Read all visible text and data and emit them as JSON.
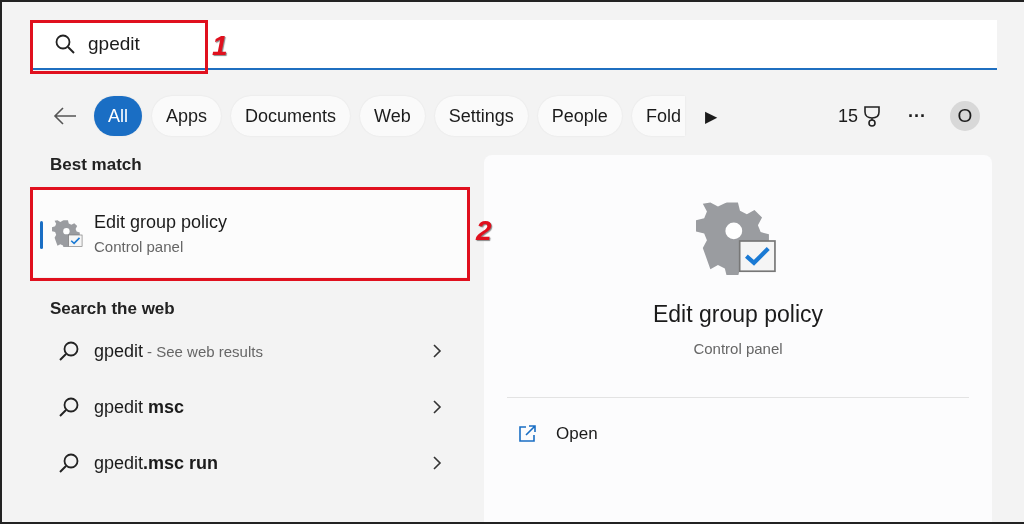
{
  "search": {
    "value": "gpedit"
  },
  "filters": [
    {
      "label": "All",
      "selected": true
    },
    {
      "label": "Apps",
      "selected": false
    },
    {
      "label": "Documents",
      "selected": false
    },
    {
      "label": "Web",
      "selected": false
    },
    {
      "label": "Settings",
      "selected": false
    },
    {
      "label": "People",
      "selected": false
    },
    {
      "label": "Fold",
      "selected": false
    }
  ],
  "more_filters": "▶",
  "points": "15",
  "more": "···",
  "avatar": "O",
  "best_match": {
    "heading": "Best match",
    "title": "Edit group policy",
    "subtitle": "Control panel",
    "selected": true
  },
  "web": {
    "heading": "Search the web",
    "items": [
      {
        "text": "gpedit",
        "hint": "- See web results"
      },
      {
        "text": "gpedit **msc**"
      },
      {
        "text": "gpedit**.msc run**"
      }
    ]
  },
  "details": {
    "title": "Edit group policy",
    "subtitle": "Control panel",
    "actions": [
      {
        "label": "Open"
      }
    ]
  },
  "annotations": [
    {
      "label": "1"
    },
    {
      "label": "2"
    }
  ]
}
